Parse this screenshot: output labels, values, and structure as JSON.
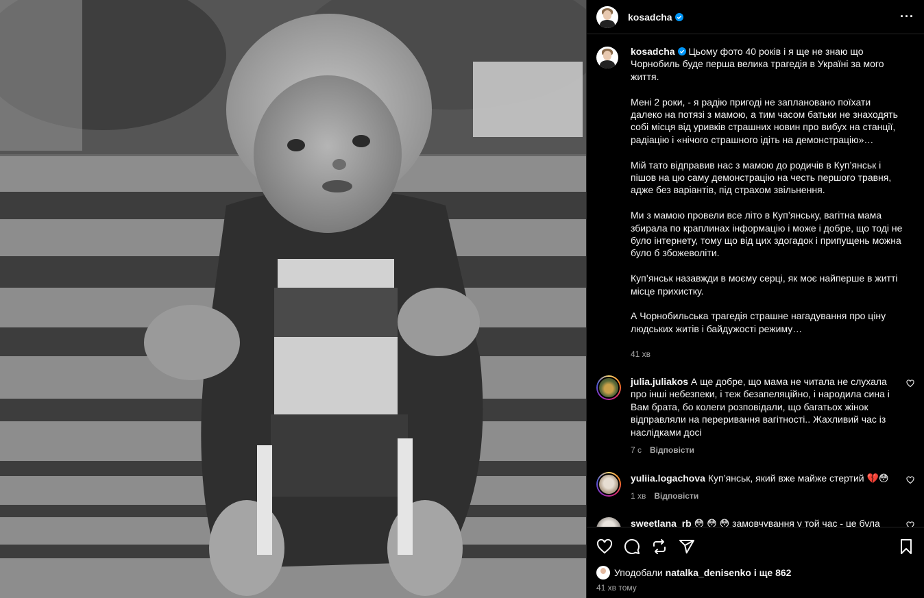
{
  "post": {
    "username": "kosadcha",
    "more_icon": "more-horizontal-icon",
    "caption": {
      "username": "kosadcha",
      "paragraphs": [
        "Цьому фото 40 років і я ще не знаю що Чорнобиль буде перша велика трагедія в Україні за мого життя.",
        "Мені 2 роки, - я радію пригоді не заплановано поїхати далеко на потязі з мамою, а тим часом батьки не знаходять собі місця від уривків страшних новин про вибух на станції, радіацію і «нічого страшного ідіть на демонстрацію»…",
        "Мій тато відправив нас з мамою до родичів в Куп’янськ і пішов на цю саму демонстрацію на честь першого травня, адже без варіантів, під страхом звільнення.",
        "Ми з мамою провели все літо в Куп’янську, вагітна мама збирала по краплинах інформацію і може і добре, що тоді не було інтернету, тому що від цих здогадок і припущень можна було б збожеволіти.",
        "Куп’янськ назавжди в моєму серці, як моє найперше в житті місце прихистку.",
        "А Чорнобильська трагедія страшне нагадування про ціну людських житів і байдужості режиму…"
      ],
      "time": "41 хв"
    },
    "comments": [
      {
        "username": "julia.juliakos",
        "text": "А ще добре, що мама не читала не слухала про інші небезпеки, і теж безапеляційно, і народила сина і Вам брата, бо колеги розповідали, що багатьох жінок відправляли на переривання вагітності.. Жахливий час із наслідками досі",
        "time": "7 с",
        "reply": "Відповісти"
      },
      {
        "username": "yuliia.logachova",
        "text": "Куп’янськ, який вже майже стертий 💔😳",
        "time": "1 хв",
        "reply": "Відповісти"
      },
      {
        "username": "sweetlana_rb",
        "text": "😳 😳 😳 замовчування у той час - це була норма! Мама розповідала теж, що у той час лише одна"
      }
    ],
    "likes": {
      "prefix": "Уподобали",
      "user": "natalka_denisenko",
      "suffix": "і ще 862"
    },
    "posted_time": "41 хв тому"
  },
  "colors": {
    "background": "#000000",
    "border": "#262626",
    "text": "#f5f5f5",
    "secondary": "#a8a8a8",
    "verified": "#0095f6"
  }
}
